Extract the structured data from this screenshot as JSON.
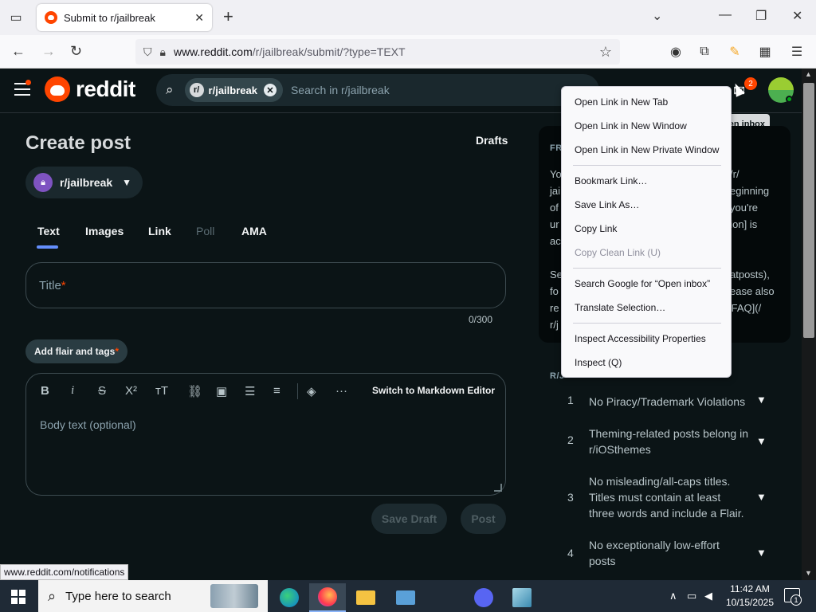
{
  "browser": {
    "tab_title": "Submit to r/jailbreak",
    "url_domain": "www.reddit.com",
    "url_path": "/r/jailbreak/submit/?type=TEXT",
    "status_url": "www.reddit.com/notifications"
  },
  "reddit": {
    "logo_text": "reddit",
    "search_chip": "r/jailbreak",
    "search_chip_avatar": "r/",
    "search_placeholder": "Search in r/jailbreak",
    "inbox_badge": "2",
    "tooltip": "en inbox"
  },
  "compose": {
    "page_title": "Create post",
    "drafts_label": "Drafts",
    "community": "r/jailbreak",
    "tabs": [
      {
        "label": "Text",
        "disabled": false
      },
      {
        "label": "Images",
        "disabled": false
      },
      {
        "label": "Link",
        "disabled": false
      },
      {
        "label": "Poll",
        "disabled": true
      },
      {
        "label": "AMA",
        "disabled": false
      }
    ],
    "title_placeholder": "Title",
    "required_mark": "*",
    "char_count": "0/300",
    "flair_label": "Add flair and tags",
    "markdown_switch": "Switch to Markdown Editor",
    "body_placeholder": "Body text (optional)",
    "save_draft": "Save Draft",
    "post": "Post",
    "toolbar_icons": [
      "bold-icon",
      "italic-icon",
      "strikethrough-icon",
      "superscript-icon",
      "heading-icon",
      "link-icon",
      "image-icon",
      "bullet-list-icon",
      "numbered-list-icon",
      "spoiler-icon",
      "more-icon"
    ]
  },
  "sidebar": {
    "about_heading": "FR",
    "about_left_lines": [
      "Yo",
      "jai",
      "of",
      "ur",
      "ac",
      "",
      "Se",
      "fo",
      "re",
      "r/j"
    ],
    "about_right_lines": [
      "/r/",
      "eginning",
      "you're",
      "ussion] is",
      "",
      "",
      "atposts),",
      "ease also",
      "s), [FAQ](/",
      ""
    ],
    "rules_heading": "R/J",
    "rules": [
      {
        "num": "1",
        "text": "No Piracy/Trademark Violations"
      },
      {
        "num": "2",
        "text": "Theming-related posts belong in r/iOSthemes"
      },
      {
        "num": "3",
        "text": "No misleading/all-caps titles. Titles must contain at least three words and include a Flair."
      },
      {
        "num": "4",
        "text": "No exceptionally low-effort posts"
      }
    ]
  },
  "context_menu": {
    "items": [
      {
        "label": "Open Link in New Tab",
        "disabled": false
      },
      {
        "label": "Open Link in New Window",
        "disabled": false
      },
      {
        "label": "Open Link in New Private Window",
        "disabled": false
      },
      {
        "label": "Bookmark Link…",
        "disabled": false
      },
      {
        "label": "Save Link As…",
        "disabled": false
      },
      {
        "label": "Copy Link",
        "disabled": false
      },
      {
        "label": "Copy Clean Link (U)",
        "disabled": true
      },
      {
        "label": "Search Google for “Open inbox”",
        "disabled": false
      },
      {
        "label": "Translate Selection…",
        "disabled": false
      },
      {
        "label": "Inspect Accessibility Properties",
        "disabled": false
      },
      {
        "label": "Inspect (Q)",
        "disabled": false
      }
    ]
  },
  "taskbar": {
    "search_text": "Type here to search",
    "time": "11:42 AM",
    "date": "10/15/2025",
    "notification_count": "1"
  },
  "colors": {
    "reddit_orange": "#ff4500",
    "tab_underline": "#648efc",
    "page_bg": "#0b1416"
  }
}
